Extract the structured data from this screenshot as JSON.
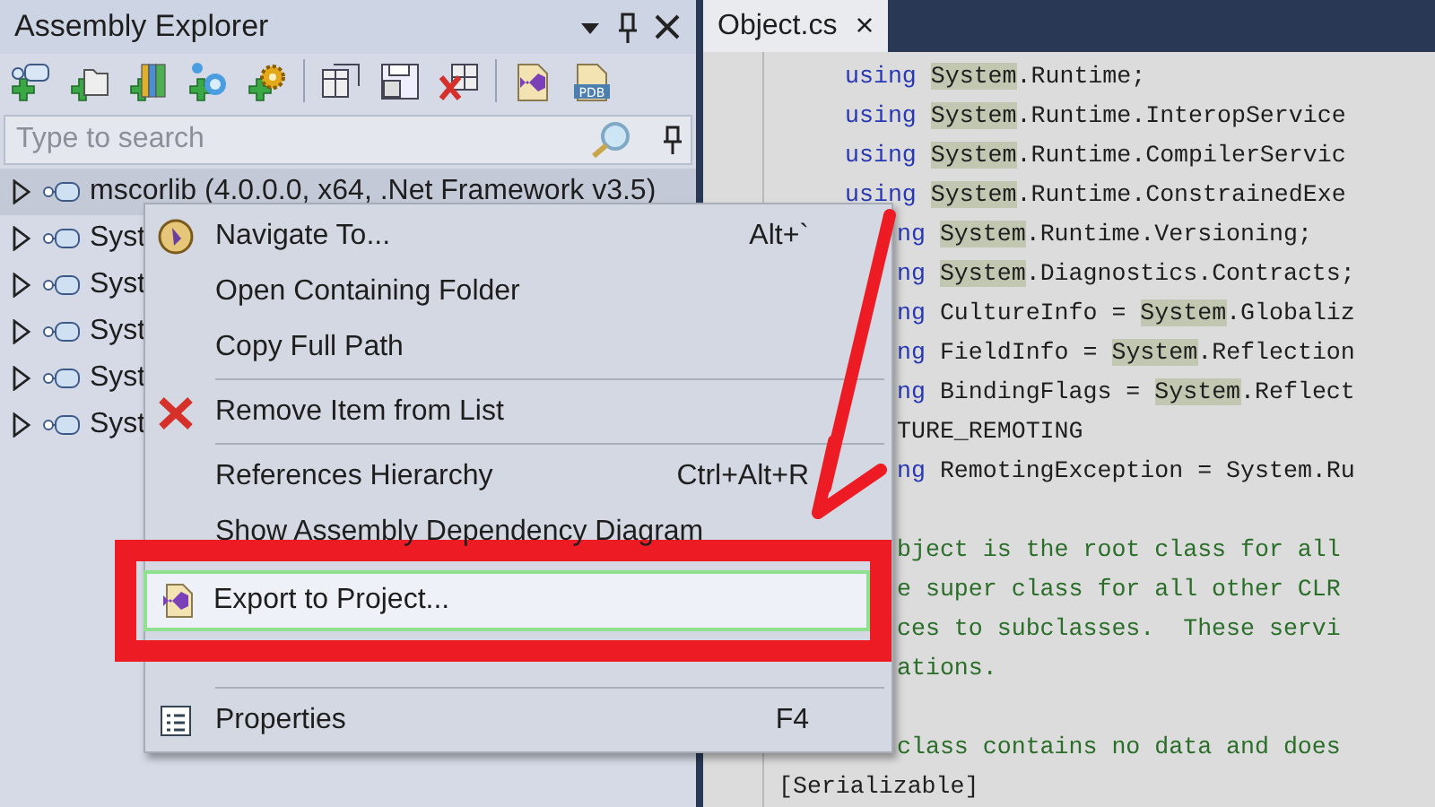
{
  "panel": {
    "title": "Assembly Explorer",
    "toolbar": [
      {
        "kind": "add-assembly"
      },
      {
        "kind": "add-folder"
      },
      {
        "kind": "add-books"
      },
      {
        "kind": "add-nodes"
      },
      {
        "kind": "add-gear"
      },
      {
        "kind": "separator"
      },
      {
        "kind": "window"
      },
      {
        "kind": "save"
      },
      {
        "kind": "delete"
      },
      {
        "kind": "separator"
      },
      {
        "kind": "project-file"
      },
      {
        "kind": "pdb-file",
        "label": "PDB"
      }
    ],
    "search": {
      "placeholder": "Type to search"
    },
    "tree": [
      {
        "label": "mscorlib (4.0.0.0, x64, .Net Framework v3.5)",
        "selected": true
      },
      {
        "label": "Syst",
        "selected": false
      },
      {
        "label": "Syst",
        "selected": false
      },
      {
        "label": "Syst",
        "selected": false
      },
      {
        "label": "Syst",
        "selected": false
      },
      {
        "label": "Syst",
        "selected": false
      }
    ]
  },
  "editor": {
    "tabs": [
      {
        "label": "Object.cs",
        "close": "×",
        "selected": true
      }
    ],
    "lines": [
      {
        "kind": "indented",
        "parts": [
          {
            "text": "using ",
            "kind": "keyword"
          },
          {
            "text": "System",
            "kind": "highlight"
          },
          {
            "text": ".Runtime;",
            "kind": "plain"
          }
        ]
      },
      {
        "kind": "indented",
        "parts": [
          {
            "text": "using ",
            "kind": "keyword"
          },
          {
            "text": "System",
            "kind": "highlight"
          },
          {
            "text": ".Runtime.InteropService",
            "kind": "plain"
          }
        ]
      },
      {
        "kind": "indented",
        "parts": [
          {
            "text": "using ",
            "kind": "keyword"
          },
          {
            "text": "System",
            "kind": "highlight"
          },
          {
            "text": ".Runtime.CompilerServic",
            "kind": "plain"
          }
        ]
      },
      {
        "kind": "indented",
        "parts": [
          {
            "text": "using ",
            "kind": "keyword"
          },
          {
            "text": "System",
            "kind": "highlight"
          },
          {
            "text": ".Runtime.ConstrainedExe",
            "kind": "plain"
          }
        ]
      },
      {
        "kind": "clipped",
        "parts": [
          {
            "text": "ng ",
            "kind": "keyword"
          },
          {
            "text": "System",
            "kind": "highlight"
          },
          {
            "text": ".Runtime.Versioning;",
            "kind": "plain"
          }
        ]
      },
      {
        "kind": "clipped",
        "parts": [
          {
            "text": "ng ",
            "kind": "keyword"
          },
          {
            "text": "System",
            "kind": "highlight"
          },
          {
            "text": ".Diagnostics.Contracts;",
            "kind": "plain"
          }
        ]
      },
      {
        "kind": "clipped",
        "parts": [
          {
            "text": "ng ",
            "kind": "keyword"
          },
          {
            "text": "CultureInfo = ",
            "kind": "plain"
          },
          {
            "text": "System",
            "kind": "highlight"
          },
          {
            "text": ".Globaliz",
            "kind": "plain"
          }
        ]
      },
      {
        "kind": "clipped",
        "parts": [
          {
            "text": "ng ",
            "kind": "keyword"
          },
          {
            "text": "FieldInfo = ",
            "kind": "plain"
          },
          {
            "text": "System",
            "kind": "highlight"
          },
          {
            "text": ".Reflection",
            "kind": "plain"
          }
        ]
      },
      {
        "kind": "clipped",
        "parts": [
          {
            "text": "ng ",
            "kind": "keyword"
          },
          {
            "text": "BindingFlags = ",
            "kind": "plain"
          },
          {
            "text": "System",
            "kind": "highlight"
          },
          {
            "text": ".Reflect",
            "kind": "plain"
          }
        ]
      },
      {
        "kind": "clipped",
        "parts": [
          {
            "text": "TURE_REMOTING",
            "kind": "plain"
          }
        ]
      },
      {
        "kind": "clipped",
        "parts": [
          {
            "text": "ng ",
            "kind": "keyword"
          },
          {
            "text": "RemotingException = System.Ru",
            "kind": "plain"
          }
        ]
      },
      {
        "kind": "blank"
      },
      {
        "kind": "clipped",
        "parts": [
          {
            "text": "bject is the root class for all",
            "kind": "comment"
          }
        ]
      },
      {
        "kind": "clipped",
        "parts": [
          {
            "text": "e super class for all other CLR",
            "kind": "comment"
          }
        ]
      },
      {
        "kind": "clipped",
        "parts": [
          {
            "text": "ces to subclasses.  These servi",
            "kind": "comment"
          }
        ]
      },
      {
        "kind": "clipped",
        "parts": [
          {
            "text": "ations.",
            "kind": "comment"
          }
        ]
      },
      {
        "kind": "blank"
      },
      {
        "kind": "clipped",
        "parts": [
          {
            "text": "class contains no data and does",
            "kind": "comment"
          }
        ]
      },
      {
        "kind": "outer",
        "parts": [
          {
            "text": "[Serializable]",
            "kind": "plain"
          }
        ]
      }
    ]
  },
  "context_menu": [
    {
      "kind": "navigate-item",
      "label": "Navigate To...",
      "shortcut": "Alt+`",
      "selected": false
    },
    {
      "kind": "item",
      "label": "Open Containing Folder",
      "selected": false
    },
    {
      "kind": "item",
      "label": "Copy Full Path",
      "selected": false
    },
    {
      "kind": "separator"
    },
    {
      "kind": "remove-item",
      "label": "Remove Item from List",
      "selected": false
    },
    {
      "kind": "separator"
    },
    {
      "kind": "item",
      "label": "References Hierarchy",
      "shortcut": "Ctrl+Alt+R",
      "selected": false
    },
    {
      "kind": "item",
      "label": "Show Assembly Dependency Diagram",
      "selected": false
    },
    {
      "kind": "export-item",
      "label": "Export to Project...",
      "selected": true
    },
    {
      "kind": "separator"
    },
    {
      "kind": "properties-item",
      "label": "Properties",
      "shortcut": "F4",
      "selected": false
    }
  ]
}
